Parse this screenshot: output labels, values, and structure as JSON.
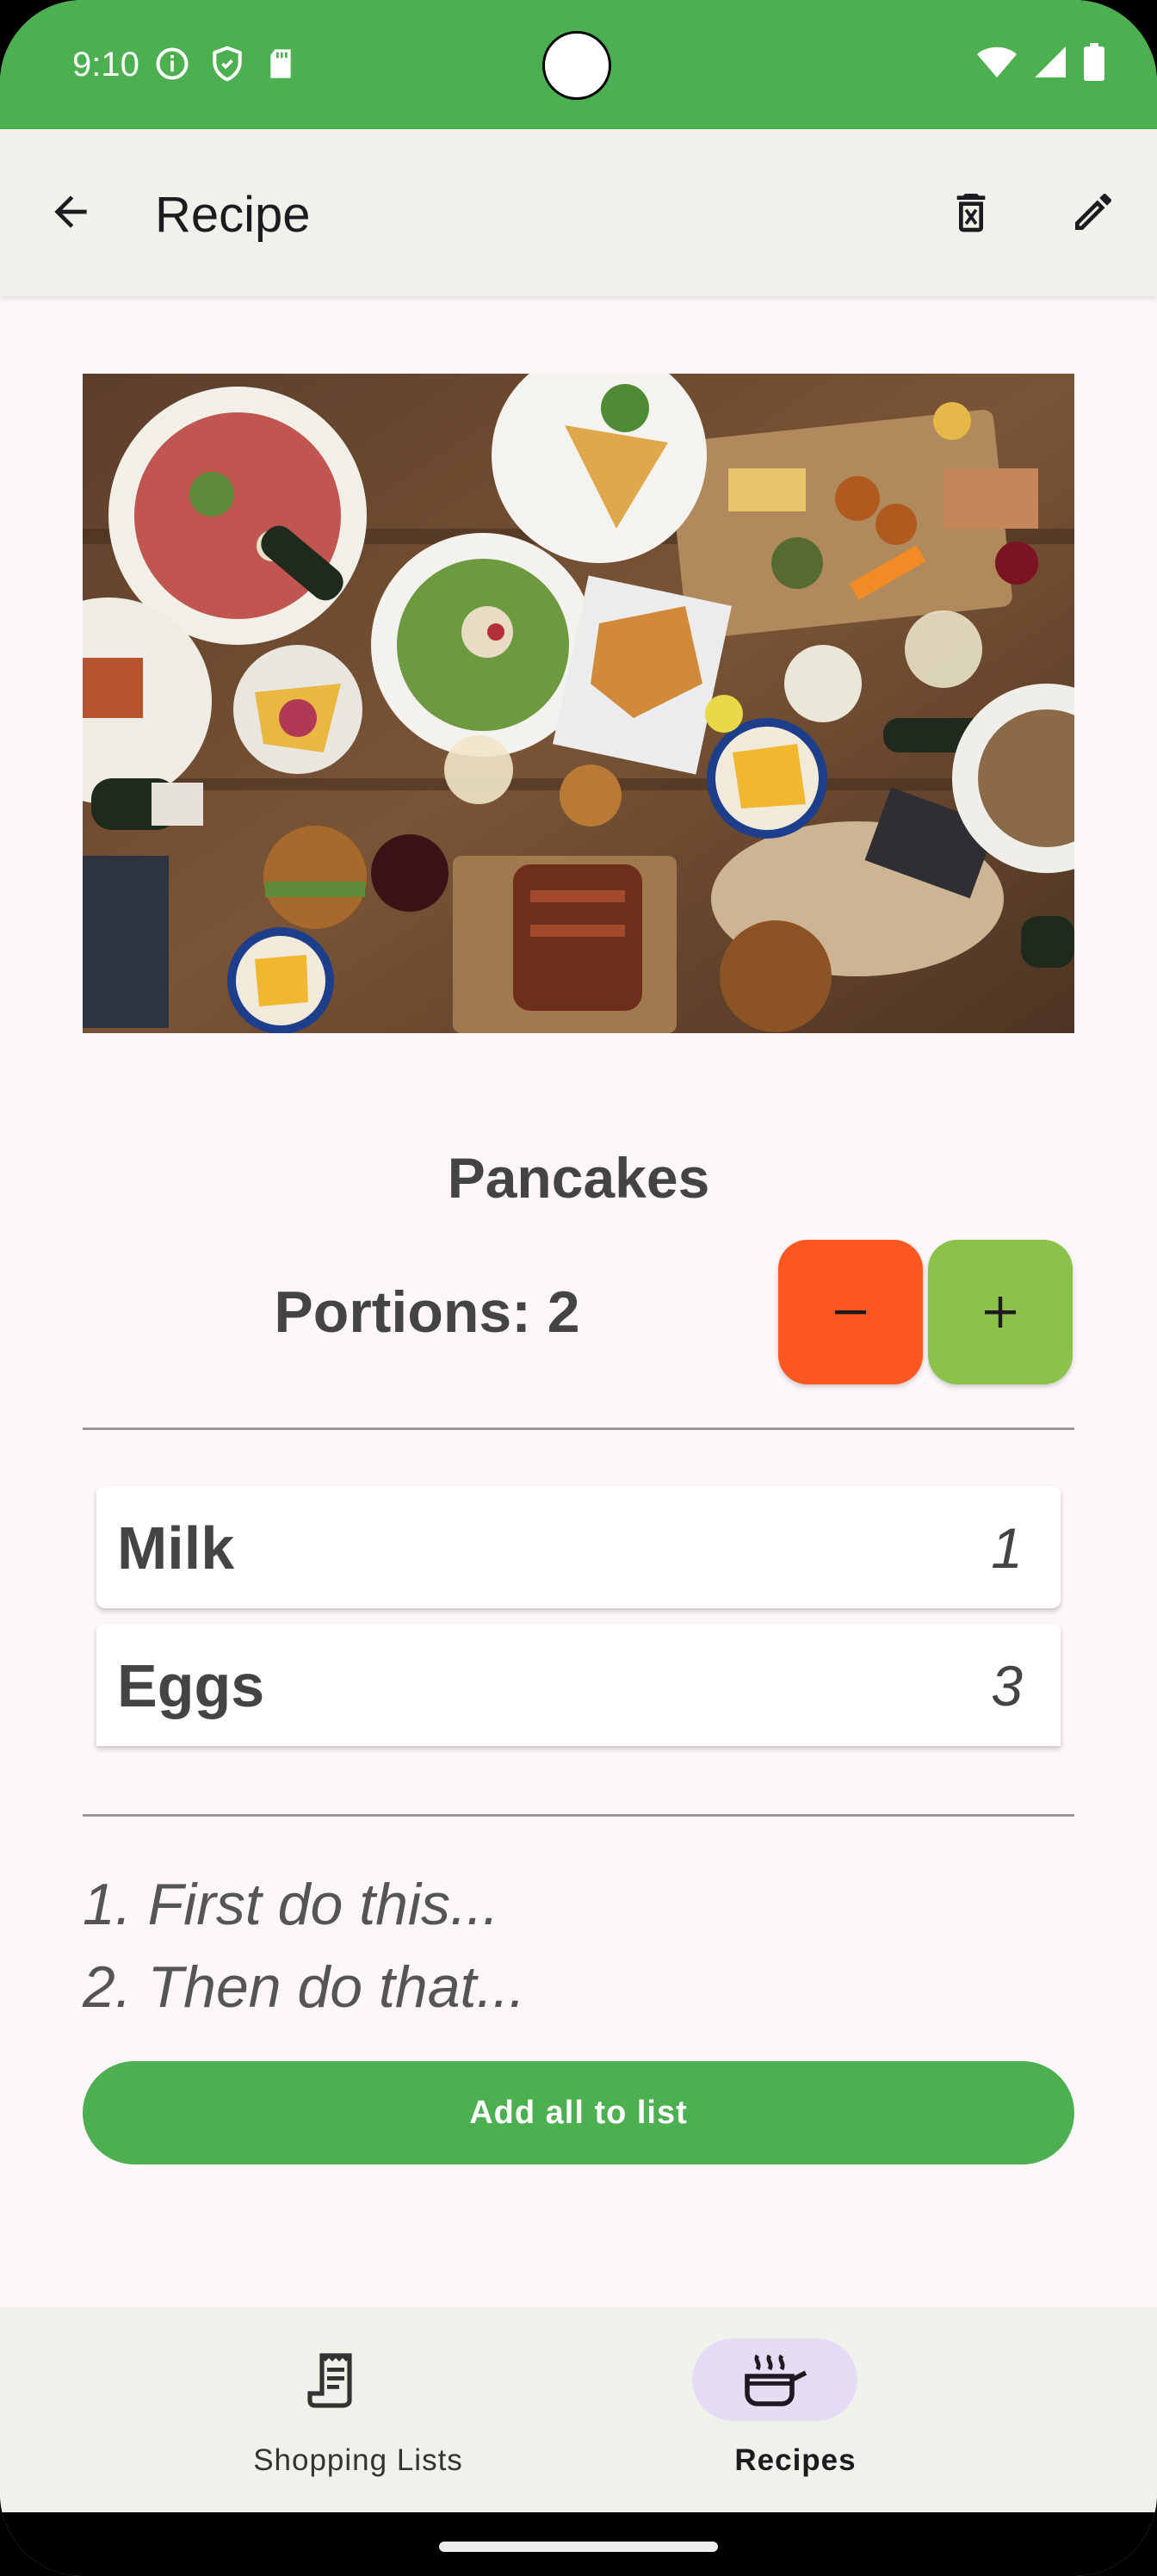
{
  "status_bar": {
    "time": "9:10",
    "icons_left": [
      "info-icon",
      "shield-icon",
      "sd-card-icon"
    ],
    "icons_right": [
      "wifi-icon",
      "signal-icon",
      "battery-icon"
    ]
  },
  "app_bar": {
    "title": "Recipe",
    "back_icon": "arrow-back-icon",
    "delete_icon": "delete-icon",
    "edit_icon": "edit-icon"
  },
  "recipe": {
    "image": "food-table-photo",
    "name": "Pancakes",
    "portions_label": "Portions: ",
    "portions_value": "2",
    "decrease_label": "−",
    "increase_label": "+",
    "ingredients": [
      {
        "name": "Milk",
        "quantity": "1"
      },
      {
        "name": "Eggs",
        "quantity": "3"
      }
    ],
    "instructions": [
      "1. First do this...",
      "2. Then do that..."
    ],
    "add_all_label": "Add all to list"
  },
  "bottom_nav": {
    "items": [
      {
        "label": "Shopping Lists",
        "icon": "receipt-icon",
        "active": false
      },
      {
        "label": "Recipes",
        "icon": "cooking-pot-icon",
        "active": true
      }
    ]
  },
  "colors": {
    "primary": "#4caf50",
    "decrease": "#ff5722",
    "increase": "#8bc34a",
    "nav_indicator": "#e7dcf6"
  }
}
